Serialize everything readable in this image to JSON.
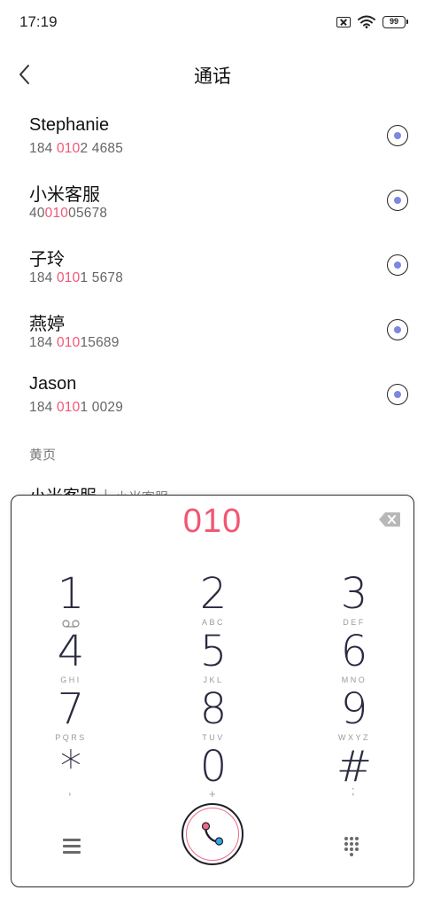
{
  "status_bar": {
    "time": "17:19",
    "battery": "99"
  },
  "header": {
    "title": "通话"
  },
  "contacts": [
    {
      "name": "Stephanie",
      "num_pre": "184 ",
      "num_hl": "010",
      "num_post": "2 4685"
    },
    {
      "name": "小米客服",
      "num_pre": "40",
      "num_hl": "010",
      "num_post": "05678"
    },
    {
      "name": "子玲",
      "num_pre": "184 ",
      "num_hl": "010",
      "num_post": "1 5678"
    },
    {
      "name": "燕婷",
      "num_pre": "184 ",
      "num_hl": "010",
      "num_post": "15689"
    },
    {
      "name": "Jason",
      "num_pre": "184 ",
      "num_hl": "010",
      "num_post": "1 0029"
    }
  ],
  "yellow_pages": {
    "label": "黄页",
    "item_name": "小米客服",
    "separator": "|",
    "item_sub": "小米客服"
  },
  "dialpad": {
    "input": "010",
    "keys": [
      {
        "digit": "1",
        "letters": ""
      },
      {
        "digit": "2",
        "letters": "ABC"
      },
      {
        "digit": "3",
        "letters": "DEF"
      },
      {
        "digit": "4",
        "letters": "GHI"
      },
      {
        "digit": "5",
        "letters": "JKL"
      },
      {
        "digit": "6",
        "letters": "MNO"
      },
      {
        "digit": "7",
        "letters": "PQRS"
      },
      {
        "digit": "8",
        "letters": "TUV"
      },
      {
        "digit": "9",
        "letters": "WXYZ"
      },
      {
        "digit": "*",
        "letters": ","
      },
      {
        "digit": "0",
        "letters": "+"
      },
      {
        "digit": "#",
        "letters": ";"
      }
    ]
  },
  "colors": {
    "highlight": "#f25573",
    "accent": "#7a88e0",
    "call_red": "#f06a85",
    "call_blue": "#2fa8e8"
  },
  "icons": {
    "back": "chevron-left-icon",
    "detail": "radio-detail-icon",
    "backspace": "backspace-icon",
    "menu": "menu-icon",
    "call": "phone-icon",
    "keypad": "keypad-icon",
    "voicemail": "voicemail-icon"
  }
}
